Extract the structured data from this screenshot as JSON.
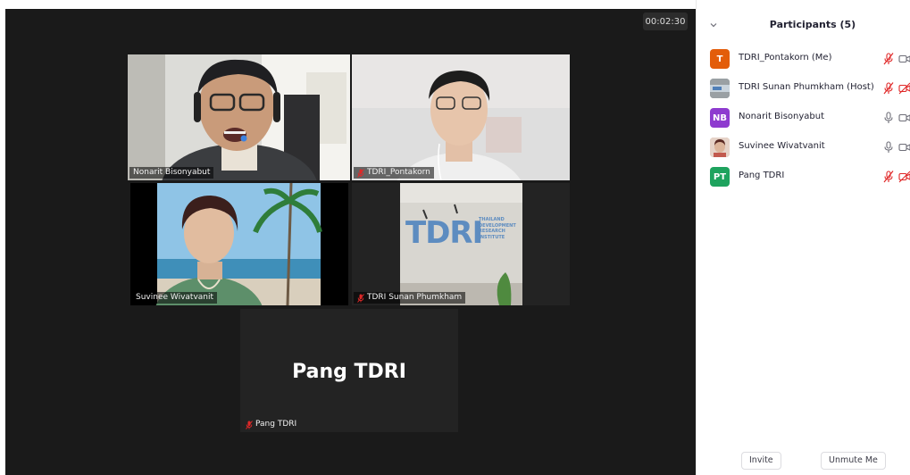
{
  "meeting": {
    "elapsed_time": "00:02:30"
  },
  "tiles": {
    "nonarit": {
      "name": "Nonarit Bisonyabut"
    },
    "pontakorn": {
      "name": "TDRI_Pontakorn"
    },
    "suvinee": {
      "name": "Suvinee Wivatvanit"
    },
    "sunan": {
      "name": "TDRI Sunan Phumkham",
      "wall_logo": "TDRI",
      "wall_text": [
        "THAILAND",
        "DEVELOPMENT",
        "RESEARCH",
        "INSTITUTE"
      ]
    },
    "pang": {
      "name": "Pang TDRI",
      "big_name": "Pang TDRI"
    }
  },
  "participants_panel": {
    "title": "Participants (5)",
    "participants": [
      {
        "initials": "T",
        "name": "TDRI_Pontakorn (Me)",
        "avatar_color": "#e35d0a",
        "mic": "muted",
        "camera": "off"
      },
      {
        "initials": "",
        "name": "TDRI Sunan Phumkham (Host)",
        "avatar_color": "#8a8f93",
        "mic": "muted",
        "camera": "off-red"
      },
      {
        "initials": "NB",
        "name": "Nonarit Bisonyabut",
        "avatar_color": "#8e3bcf",
        "mic": "on",
        "camera": "off"
      },
      {
        "initials": "",
        "name": "Suvinee Wivatvanit",
        "avatar_color": "#c9a48f",
        "mic": "on",
        "camera": "off"
      },
      {
        "initials": "PT",
        "name": "Pang TDRI",
        "avatar_color": "#1ea35e",
        "mic": "muted",
        "camera": "off-red"
      }
    ],
    "invite_label": "Invite",
    "unmute_label": "Unmute Me"
  },
  "colors": {
    "active_speaker": "#c3e35e",
    "muted_red": "#e02828"
  }
}
